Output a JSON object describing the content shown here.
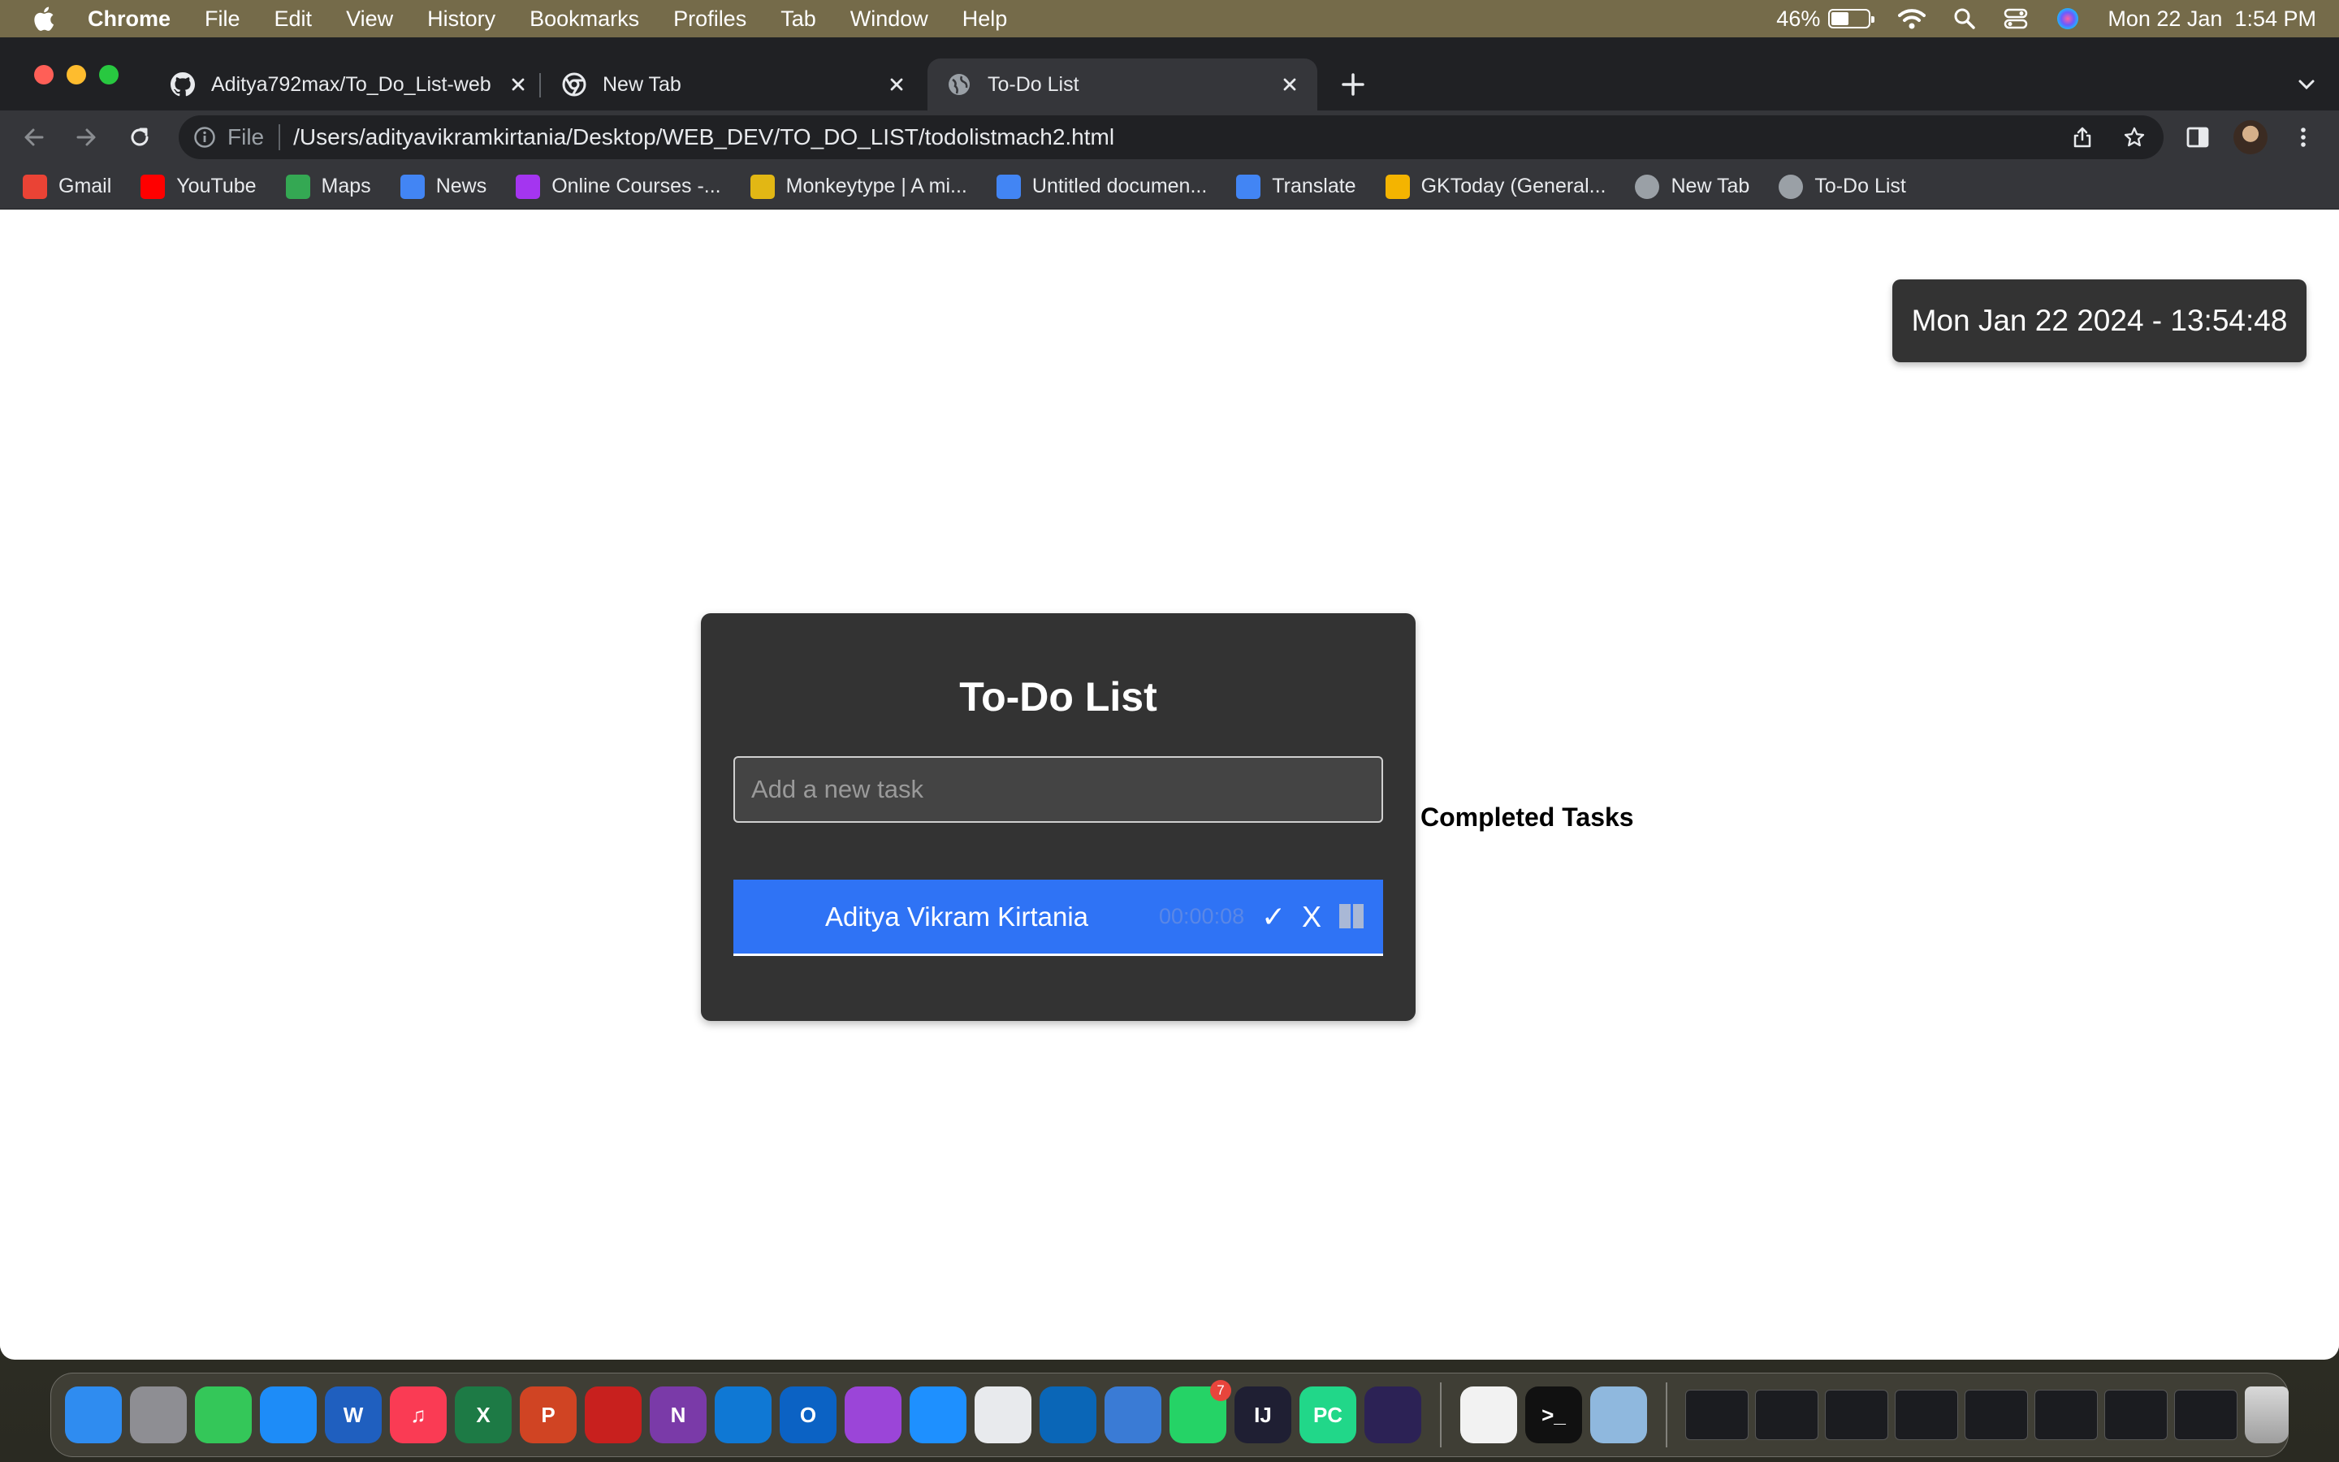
{
  "menubar": {
    "app_name": "Chrome",
    "items": [
      "File",
      "Edit",
      "View",
      "History",
      "Bookmarks",
      "Profiles",
      "Tab",
      "Window",
      "Help"
    ],
    "battery_percent": "46%",
    "battery_level": 0.46,
    "datetime": "Mon 22 Jan  1:54 PM"
  },
  "tabs": [
    {
      "title": "Aditya792max/To_Do_List-web",
      "icon": "github-icon",
      "active": false
    },
    {
      "title": "New Tab",
      "icon": "chrome-icon",
      "active": false
    },
    {
      "title": "To-Do List",
      "icon": "globe-icon",
      "active": true
    }
  ],
  "omnibox": {
    "scheme_label": "File",
    "url": "/Users/adityavikramkirtania/Desktop/WEB_DEV/TO_DO_LIST/todolistmach2.html"
  },
  "bookmarks": [
    {
      "label": "Gmail",
      "icon": "gmail-icon",
      "color": "#ea4335"
    },
    {
      "label": "YouTube",
      "icon": "youtube-icon",
      "color": "#ff0000"
    },
    {
      "label": "Maps",
      "icon": "maps-icon",
      "color": "#34a853"
    },
    {
      "label": "News",
      "icon": "news-icon",
      "color": "#4285f4"
    },
    {
      "label": "Online Courses -...",
      "icon": "udemy-icon",
      "color": "#a435f0"
    },
    {
      "label": "Monkeytype | A mi...",
      "icon": "monkeytype-icon",
      "color": "#e2b714"
    },
    {
      "label": "Untitled documen...",
      "icon": "docs-icon",
      "color": "#4285f4"
    },
    {
      "label": "Translate",
      "icon": "translate-icon",
      "color": "#4285f4"
    },
    {
      "label": "GKToday (General...",
      "icon": "gktoday-icon",
      "color": "#f4b400"
    },
    {
      "label": "New Tab",
      "icon": "globe-icon",
      "color": "#9aa0a6"
    },
    {
      "label": "To-Do List",
      "icon": "globe-icon",
      "color": "#9aa0a6"
    }
  ],
  "page": {
    "datetime": "Mon Jan 22 2024 - 13:54:48",
    "title": "To-Do List",
    "input_placeholder": "Add a new task",
    "task": {
      "name": "Aditya Vikram Kirtania",
      "timer": "00:00:08",
      "complete_symbol": "✓",
      "delete_symbol": "X"
    },
    "completed_heading": "Completed Tasks",
    "colors": {
      "task_bg": "#2f73f5",
      "card_bg": "#333333"
    }
  },
  "dock": {
    "apps": [
      {
        "name": "finder-icon",
        "color": "#2f8cf0",
        "label": ""
      },
      {
        "name": "launchpad-icon",
        "color": "#8e8e93",
        "label": ""
      },
      {
        "name": "facetime-icon",
        "color": "#34c759",
        "label": ""
      },
      {
        "name": "app-store-icon",
        "color": "#1d8cf8",
        "label": ""
      },
      {
        "name": "word-icon",
        "color": "#1f5fbf",
        "label": "W"
      },
      {
        "name": "music-icon",
        "color": "#fa3b54",
        "label": "♫"
      },
      {
        "name": "excel-icon",
        "color": "#1d7a45",
        "label": "X"
      },
      {
        "name": "powerpoint-icon",
        "color": "#d04423",
        "label": "P"
      },
      {
        "name": "acrobat-icon",
        "color": "#c8201e",
        "label": ""
      },
      {
        "name": "onenote-icon",
        "color": "#7a3aa8",
        "label": "N"
      },
      {
        "name": "onedrive-icon",
        "color": "#0f78d4",
        "label": ""
      },
      {
        "name": "outlook-icon",
        "color": "#0b62c4",
        "label": "O"
      },
      {
        "name": "podcasts-icon",
        "color": "#9b45d8",
        "label": ""
      },
      {
        "name": "safari-icon",
        "color": "#1e90ff",
        "label": ""
      },
      {
        "name": "chrome-dock-icon",
        "color": "#e8eaed",
        "label": ""
      },
      {
        "name": "vscode-icon",
        "color": "#0a66b7",
        "label": ""
      },
      {
        "name": "xcode-instruments-icon",
        "color": "#3a7bd5",
        "label": ""
      },
      {
        "name": "whatsapp-icon",
        "color": "#25d366",
        "label": "",
        "badge": "7"
      },
      {
        "name": "intellij-icon",
        "color": "#1f1f33",
        "label": "IJ"
      },
      {
        "name": "pycharm-icon",
        "color": "#21d789",
        "label": "PC"
      },
      {
        "name": "eclipse-icon",
        "color": "#2c2255",
        "label": ""
      }
    ],
    "utils": [
      {
        "name": "textedit-icon",
        "color": "#f2f2f2",
        "label": ""
      },
      {
        "name": "terminal-icon",
        "color": "#111111",
        "label": ">_"
      },
      {
        "name": "preview-icon",
        "color": "#8fb8de",
        "label": ""
      }
    ],
    "trash_label": ""
  }
}
